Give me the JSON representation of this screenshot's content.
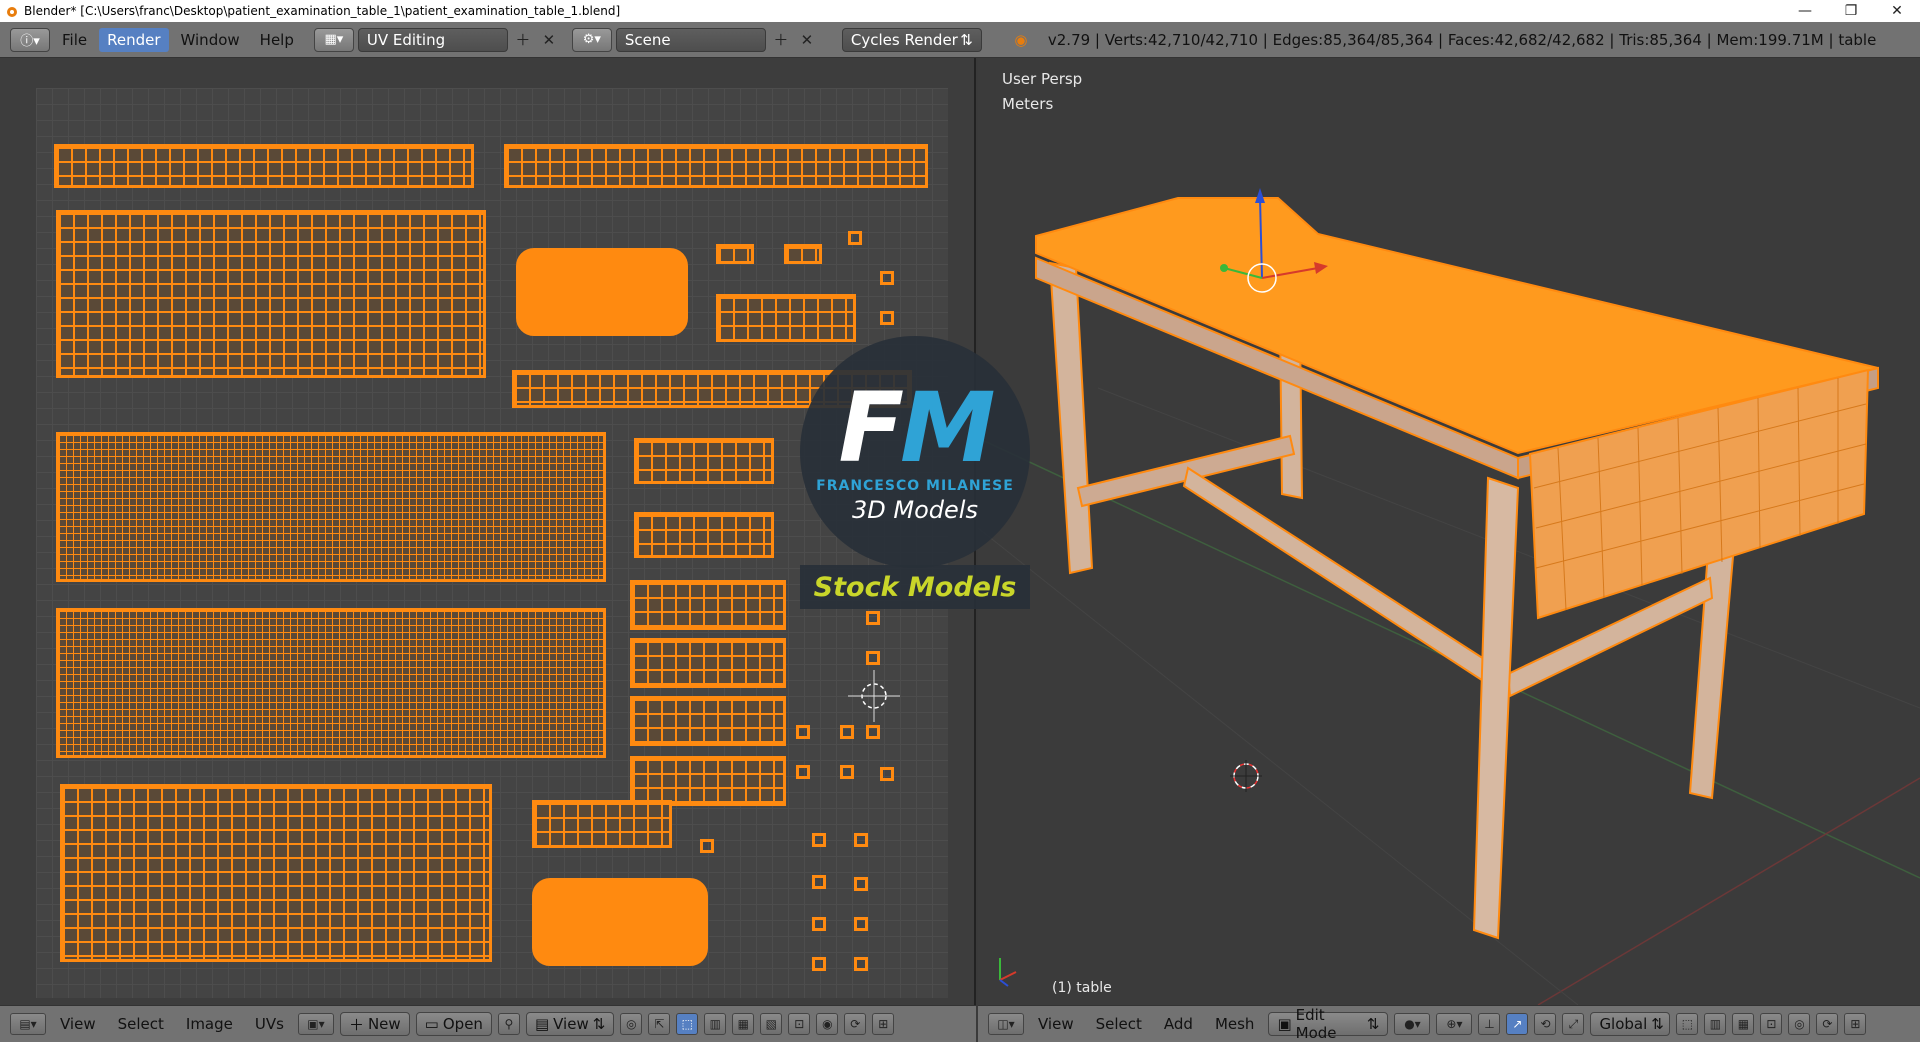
{
  "window": {
    "title": "Blender* [C:\\Users\\franc\\Desktop\\patient_examination_table_1\\patient_examination_table_1.blend]",
    "minimize": "—",
    "maximize": "❐",
    "close": "✕"
  },
  "infobar": {
    "menus": [
      "File",
      "Render",
      "Window",
      "Help"
    ],
    "active_menu": "Render",
    "layout": "UV Editing",
    "scene": "Scene",
    "engine": "Cycles Render",
    "stats": "v2.79 | Verts:42,710/42,710 | Edges:85,364/85,364 | Faces:42,682/42,682 | Tris:85,364 | Mem:199.71M | table"
  },
  "uv_editor": {
    "menus": [
      "View",
      "Select",
      "Image",
      "UVs"
    ],
    "new_label": "New",
    "open_label": "Open",
    "view_label": "View"
  },
  "viewport": {
    "perspective": "User Persp",
    "units": "Meters",
    "object": "(1) table",
    "menus": [
      "View",
      "Select",
      "Add",
      "Mesh"
    ],
    "mode": "Edit Mode",
    "orientation": "Global"
  },
  "watermark": {
    "logo_f": "F",
    "logo_m": "M",
    "brand": "FRANCESCO MILANESE",
    "tagline": "3D Models",
    "stock": "Stock Models"
  },
  "colors": {
    "selection": "#ff8a10",
    "header": "#727272",
    "active": "#5680c2"
  }
}
